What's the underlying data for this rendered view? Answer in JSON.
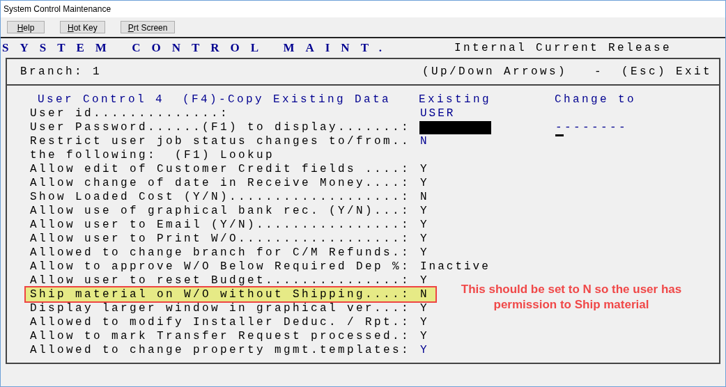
{
  "window": {
    "title": "System Control Maintenance"
  },
  "toolbar": {
    "buttons": [
      "Help",
      "Hot Key",
      "Prt Screen"
    ]
  },
  "banner": {
    "title": "SYSTEM CONTROL MAINT.",
    "release": "Internal Current Release"
  },
  "header": {
    "branch": "Branch: 1",
    "hint": "(Up/Down Arrows)   -  (Esc) Exit"
  },
  "form": {
    "title": "User Control 4  (F4)-Copy Existing Data",
    "existing_heading": "Existing",
    "change_heading": "Change to",
    "rows": [
      {
        "kind": "text",
        "label": "User id..............:",
        "value": "USER",
        "accent": true,
        "highlighted": false
      },
      {
        "kind": "masked",
        "label": "User Password......(F1) to display.......:",
        "change_to": "--------",
        "highlighted": false
      },
      {
        "kind": "text",
        "label": "Restrict user job status changes to/from..",
        "value": "N",
        "accent": true,
        "highlighted": false
      },
      {
        "kind": "note",
        "label": "the following:  (F1) Lookup",
        "highlighted": false
      },
      {
        "kind": "text",
        "label": "Allow edit of Customer Credit fields ....:",
        "value": "Y",
        "accent": false,
        "highlighted": false
      },
      {
        "kind": "text",
        "label": "Allow change of date in Receive Money....:",
        "value": "Y",
        "accent": false,
        "highlighted": false
      },
      {
        "kind": "text",
        "label": "Show Loaded Cost (Y/N)...................:",
        "value": "N",
        "accent": false,
        "highlighted": false
      },
      {
        "kind": "text",
        "label": "Allow use of graphical bank rec. (Y/N)...:",
        "value": "Y",
        "accent": false,
        "highlighted": false
      },
      {
        "kind": "text",
        "label": "Allow user to Email (Y/N)................:",
        "value": "Y",
        "accent": false,
        "highlighted": false
      },
      {
        "kind": "text",
        "label": "Allow user to Print W/O..................:",
        "value": "Y",
        "accent": false,
        "highlighted": false
      },
      {
        "kind": "text",
        "label": "Allowed to change branch for C/M Refunds.:",
        "value": "Y",
        "accent": false,
        "highlighted": false
      },
      {
        "kind": "text",
        "label": "Allow to approve W/O Below Required Dep %:",
        "value": "Inactive",
        "accent": false,
        "highlighted": false
      },
      {
        "kind": "text",
        "label": "Allow user to reset Budget...............:",
        "value": "Y",
        "accent": false,
        "highlighted": false
      },
      {
        "kind": "text",
        "label": "Ship material on W/O without Shipping....:",
        "value": "N",
        "accent": false,
        "highlighted": true
      },
      {
        "kind": "text",
        "label": "Display larger window in graphical ver...:",
        "value": "Y",
        "accent": false,
        "highlighted": false
      },
      {
        "kind": "text",
        "label": "Allowed to modify Installer Deduc. / Rpt.:",
        "value": "Y",
        "accent": false,
        "highlighted": false
      },
      {
        "kind": "text",
        "label": "Allow to mark Transfer Request processed.:",
        "value": "Y",
        "accent": false,
        "highlighted": false
      },
      {
        "kind": "text",
        "label": "Allowed to change property mgmt.templates:",
        "value": "Y",
        "accent": true,
        "highlighted": false
      }
    ]
  },
  "annotation": "This should be set to N so the user has permission to Ship material"
}
